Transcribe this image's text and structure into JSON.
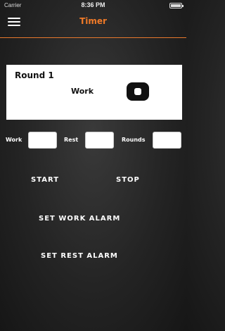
{
  "status_bar": {
    "time": "8:36 PM",
    "carrier": "Carrier"
  },
  "navbar": {
    "title": "Timer",
    "menu_icon": "hamburger-menu-icon",
    "accent_color": "#f07a28"
  },
  "timer": {
    "round_label": "Round 1",
    "phase_label": "Work",
    "control_icon": "stop-icon"
  },
  "settings": {
    "work_label": "Work",
    "rest_label": "Rest",
    "rounds_label": "Rounds",
    "work_value": "",
    "rest_value": "",
    "rounds_value": ""
  },
  "actions": {
    "start_label": "START",
    "stop_label": "STOP",
    "set_work_alarm_label": "SET WORK ALARM",
    "set_rest_alarm_label": "SET REST ALARM"
  }
}
